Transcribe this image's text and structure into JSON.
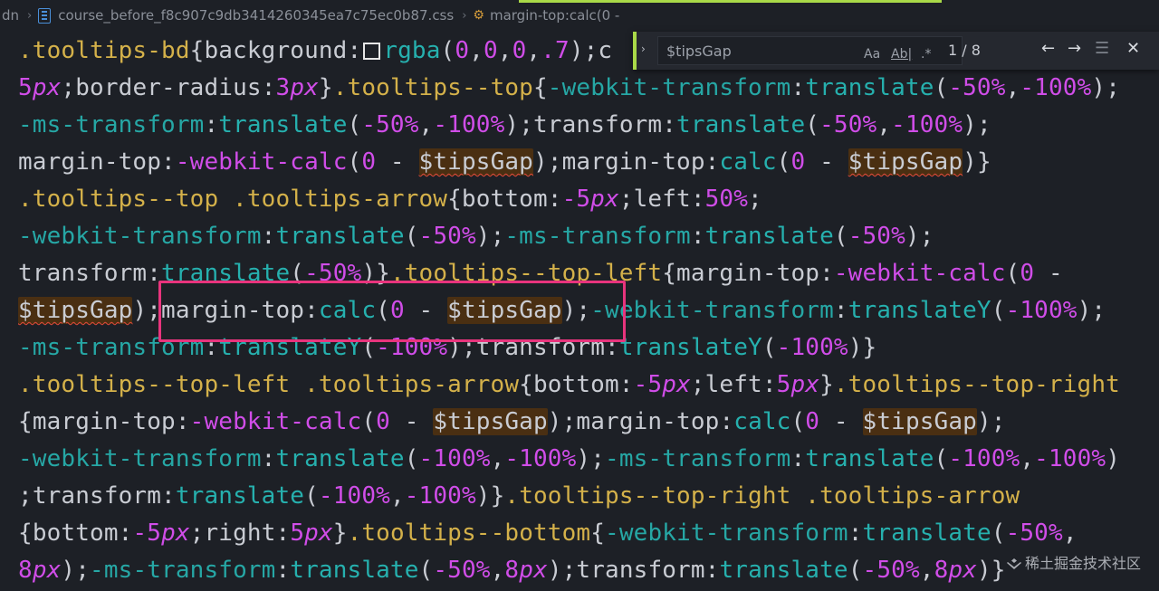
{
  "breadcrumb": {
    "folder": "dn",
    "file": "course_before_f8c907c9db3414260345ea7c75ec0b87.css",
    "symbol": "margin-top:calc(0 -",
    "file_icon": "css-file-icon",
    "symbol_icon": "symbol-property-icon"
  },
  "find": {
    "query": "$tipsGap",
    "match_case": "Aa",
    "whole_word": "Ab|",
    "regex": ".*",
    "count": "1 / 8",
    "prev_icon": "arrow-left-icon",
    "next_icon": "arrow-right-icon",
    "selection_icon": "find-in-selection-icon",
    "close_icon": "close-icon"
  },
  "code_lines": [
    ".tooltips-bd{background:□rgba(0,0,0,.7);c",
    "5px;border-radius:3px}.tooltips--top{-webkit-transform:translate(-50%,-100%);",
    "-ms-transform:translate(-50%,-100%);transform:translate(-50%,-100%);",
    "margin-top:-webkit-calc(0 - $tipsGap);margin-top:calc(0 - $tipsGap)}",
    ".tooltips--top .tooltips-arrow{bottom:-5px;left:50%;",
    "-webkit-transform:translate(-50%);-ms-transform:translate(-50%);",
    "transform:translate(-50%)}.tooltips--top-left{margin-top:-webkit-calc(0 -",
    "$tipsGap);margin-top:calc(0 - $tipsGap);-webkit-transform:translateY(-100%);",
    "-ms-transform:translateY(-100%);transform:translateY(-100%)}",
    ".tooltips--top-left .tooltips-arrow{bottom:-5px;left:5px}.tooltips--top-right",
    "{margin-top:-webkit-calc(0 - $tipsGap);margin-top:calc(0 - $tipsGap);",
    "-webkit-transform:translate(-100%,-100%);-ms-transform:translate(-100%,-100%)",
    ";transform:translate(-100%,-100%)}.tooltips--top-right .tooltips-arrow",
    "{bottom:-5px;right:5px}.tooltips--bottom{-webkit-transform:translate(-50%,",
    "8px);-ms-transform:translate(-50%,8px);transform:translate(-50%,8px)}"
  ],
  "colors": {
    "background": "#1d2026",
    "selector": "#d4b14a",
    "property": "#26a7a5",
    "number": "#d04de8",
    "match_highlight": "#4a2f12",
    "annotation_box": "#e8347d",
    "find_accent": "#a9d948"
  },
  "watermark": "稀土掘金技术社区"
}
